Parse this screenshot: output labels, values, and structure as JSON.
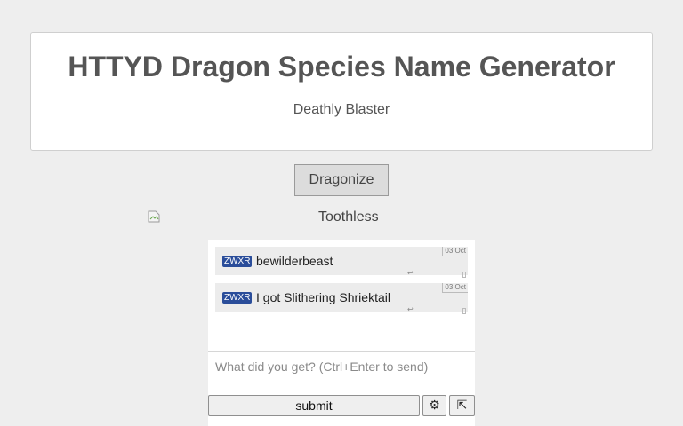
{
  "header": {
    "title": "HTTYD Dragon Species Name Generator",
    "result": "Deathly Blaster"
  },
  "generator": {
    "button_label": "Dragonize"
  },
  "image": {
    "alt": "Toothless"
  },
  "chat": {
    "messages": [
      {
        "tag": "ZWXR",
        "text": "bewilderbeast",
        "date": "03 Oct"
      },
      {
        "tag": "ZWXR",
        "text": "I got Slithering Shriektail",
        "date": "03 Oct"
      }
    ],
    "input_placeholder": "What did you get? (Ctrl+Enter to send)",
    "submit_label": "submit",
    "settings_icon": "⚙",
    "popout_icon": "⇱"
  },
  "colors": {
    "page_background": "#eeeeee",
    "tag_background": "#2a4d9a",
    "button_background": "#dcdcdc"
  }
}
